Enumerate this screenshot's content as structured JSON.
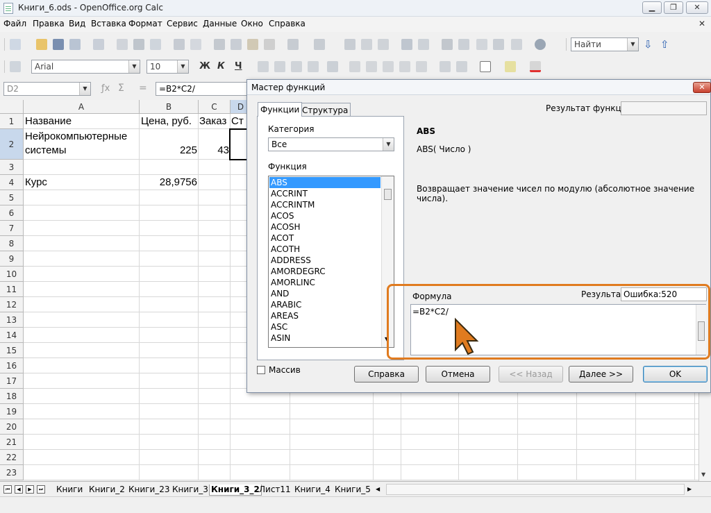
{
  "window": {
    "title": "Книги_6.ods - OpenOffice.org Calc",
    "minimize": "▁",
    "restore": "❐",
    "close": "✕"
  },
  "menu": {
    "items": [
      "Файл",
      "Правка",
      "Вид",
      "Вставка",
      "Формат",
      "Сервис",
      "Данные",
      "Окно",
      "Справка"
    ],
    "close": "✕"
  },
  "toolbar": {
    "search_placeholder": "Найти",
    "font_name": "Arial",
    "font_size": "10",
    "bold": "Ж",
    "italic": "К",
    "underline": "Ч"
  },
  "formula_bar": {
    "cell_ref": "D2",
    "sum_icon": "Σ",
    "equals": "=",
    "content": "=B2*C2/"
  },
  "sheet": {
    "columns": [
      "A",
      "B",
      "C",
      "D"
    ],
    "rows": [
      "1",
      "2",
      "3",
      "4",
      "5",
      "6",
      "7",
      "8",
      "9",
      "10",
      "11",
      "12",
      "13",
      "14",
      "15",
      "16",
      "17",
      "18",
      "19",
      "20",
      "21",
      "22",
      "23"
    ],
    "cells": {
      "a1": "Название",
      "b1": "Цена, руб.",
      "c1": "Заказ",
      "d1": "Ст",
      "a2_line1": "Нейрокомпьютерные",
      "a2_line2": "системы",
      "b2": "225",
      "c2": "43",
      "a4": "Курс",
      "b4": "28,9756"
    },
    "tabs": [
      "Книги",
      "Книги_2",
      "Книги_23",
      "Книги_3",
      "Книги_3_2",
      "Лист11",
      "Книги_4",
      "Книги_5"
    ],
    "active_tab": "Книги_3_2"
  },
  "dialog": {
    "title": "Мастер функций",
    "tabs": [
      "Функции",
      "Структура"
    ],
    "category_label": "Категория",
    "category_value": "Все",
    "function_label": "Функция",
    "functions": [
      "ABS",
      "ACCRINT",
      "ACCRINTM",
      "ACOS",
      "ACOSH",
      "ACOT",
      "ACOTH",
      "ADDRESS",
      "AMORDEGRC",
      "AMORLINC",
      "AND",
      "ARABIC",
      "AREAS",
      "ASC",
      "ASIN"
    ],
    "selected_function": "ABS",
    "function_result_label": "Результат функции",
    "function_result_value": "",
    "func_name": "ABS",
    "func_signature": "ABS( Число )",
    "func_description": "Возвращает значение чисел по модулю (абсолютное значение числа).",
    "formula_label": "Формула",
    "result_label": "Результат",
    "result_value": "Ошибка:520",
    "formula_value": "=B2*C2/",
    "array_label": "Массив",
    "buttons": {
      "help": "Справка",
      "cancel": "Отмена",
      "back": "<< Назад",
      "next": "Далее >>",
      "ok": "OK"
    }
  },
  "colors": {
    "highlight": "#e07b1f",
    "selection": "#3399ff"
  }
}
